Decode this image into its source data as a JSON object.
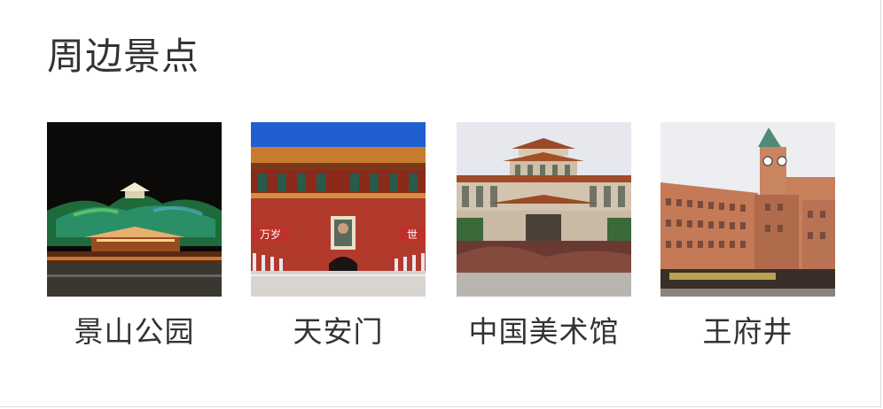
{
  "section": {
    "title": "周边景点"
  },
  "attractions": [
    {
      "name": "景山公园",
      "icon": "jingshan-park-photo"
    },
    {
      "name": "天安门",
      "icon": "tiananmen-photo",
      "banners": [
        "万岁",
        "世"
      ]
    },
    {
      "name": "中国美术馆",
      "icon": "national-art-museum-photo"
    },
    {
      "name": "王府井",
      "icon": "wangfujing-photo"
    }
  ]
}
